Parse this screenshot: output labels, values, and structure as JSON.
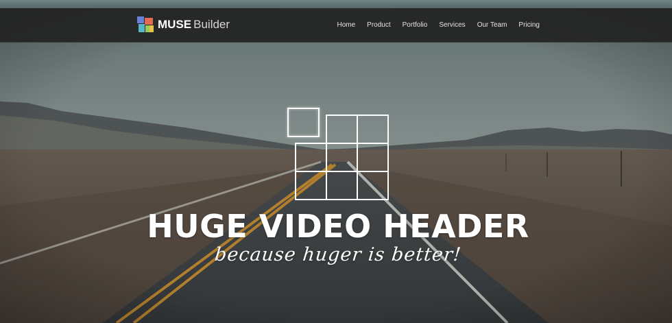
{
  "brand": {
    "name_bold": "MUSE",
    "name_light": "Builder",
    "logo_icon": "colored-squares-logo-icon"
  },
  "nav": {
    "items": [
      "Home",
      "Product",
      "Portfolio",
      "Services",
      "Our Team",
      "Pricing"
    ]
  },
  "hero": {
    "headline": "HUGE VIDEO HEADER",
    "tagline": "because huger is better!",
    "background": "desert-road-video-background",
    "emblem_icon": "grid-squares-icon"
  },
  "colors": {
    "navbar": "#222222",
    "nav_text": "#e4e4e4",
    "headline": "#ffffff"
  }
}
